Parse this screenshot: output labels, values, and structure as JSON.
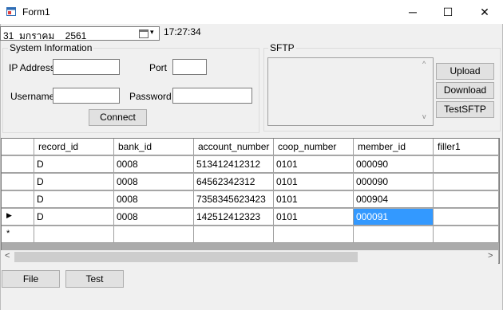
{
  "window": {
    "title": "Form1",
    "min_glyph": "─",
    "max_glyph": "☐",
    "close_glyph": "✕"
  },
  "date_picker": {
    "value": "31  มกราคม    2561",
    "dropdown_glyph": "▾"
  },
  "clock": "17:27:34",
  "system_info": {
    "legend": "System Information",
    "ip_label": "IP Address",
    "ip_value": "",
    "port_label": "Port",
    "port_value": "",
    "username_label": "Username",
    "username_value": "",
    "password_label": "Password",
    "password_value": "",
    "connect_label": "Connect"
  },
  "sftp": {
    "legend": "SFTP",
    "log_value": "",
    "upload_label": "Upload",
    "download_label": "Download",
    "test_label": "TestSFTP",
    "scroll_up_glyph": "^",
    "scroll_down_glyph": "v"
  },
  "grid": {
    "columns": [
      "record_id",
      "bank_id",
      "account_number",
      "coop_number",
      "member_id",
      "filler1"
    ],
    "rows": [
      {
        "indicator": "",
        "cells": [
          "D",
          "0008",
          "513412412312",
          "0101",
          "000090",
          ""
        ]
      },
      {
        "indicator": "",
        "cells": [
          "D",
          "0008",
          "64562342312",
          "0101",
          "000090",
          ""
        ]
      },
      {
        "indicator": "",
        "cells": [
          "D",
          "0008",
          "7358345623423",
          "0101",
          "000904",
          ""
        ]
      },
      {
        "indicator": "▶",
        "cells": [
          "D",
          "0008",
          "142512412323",
          "0101",
          "000091",
          ""
        ]
      },
      {
        "indicator": "*",
        "cells": [
          "",
          "",
          "",
          "",
          "",
          ""
        ]
      }
    ],
    "selected_row": 3,
    "selected_col": 4,
    "scroll_left_glyph": "<",
    "scroll_right_glyph": ">"
  },
  "buttons": {
    "file_label": "File",
    "test_label": "Test"
  },
  "colors": {
    "selection": "#3399ff",
    "window_bg": "#f0f0f0"
  }
}
